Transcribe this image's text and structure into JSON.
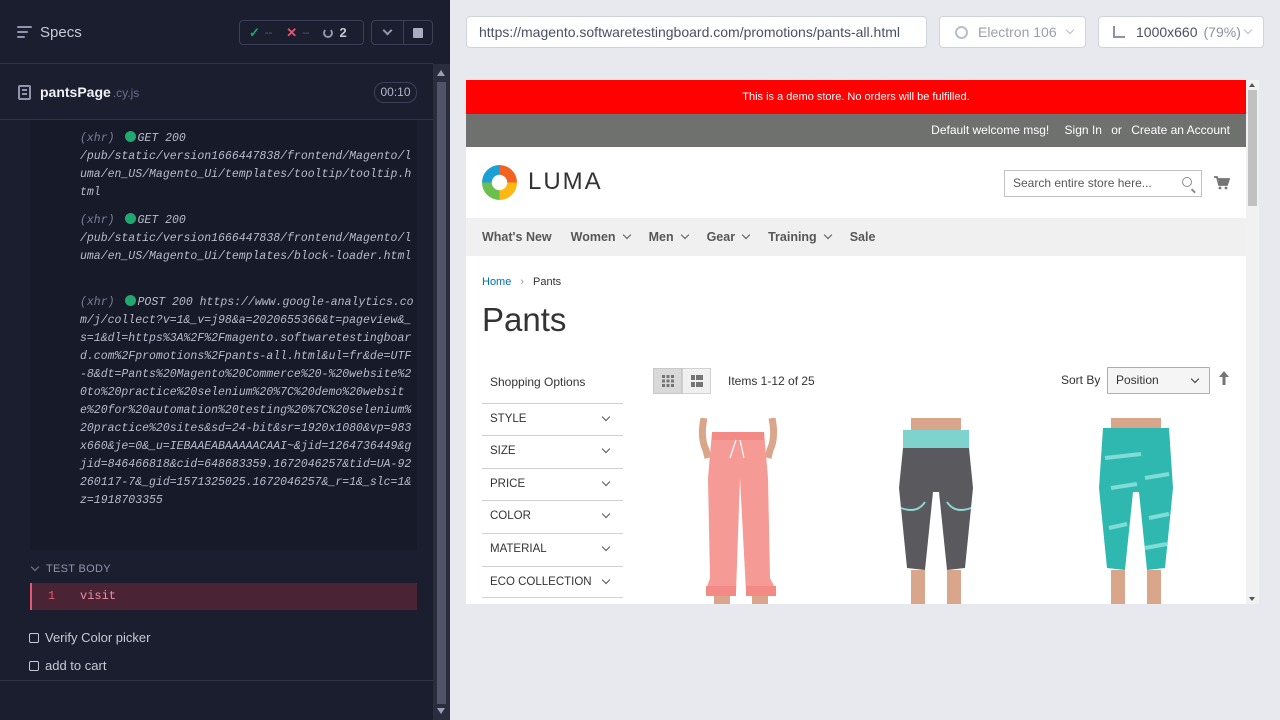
{
  "runner": {
    "specs_title": "Specs",
    "stats": {
      "passed": "--",
      "failed": "--",
      "pending": "2"
    },
    "spec": {
      "name": "pantsPage",
      "ext": ".cy.js",
      "duration": "00:10"
    },
    "log_entries": [
      {
        "prefix": "(xhr)",
        "method": "GET 200",
        "text": "/pub/static/version1666447838/frontend/Magento/luma/en_US/Magento_Ui/templates/tooltip/tooltip.html"
      },
      {
        "prefix": "(xhr)",
        "method": "GET 200",
        "text": "/pub/static/version1666447838/frontend/Magento/luma/en_US/Magento_Ui/templates/block-loader.html"
      },
      {
        "prefix": "(xhr)",
        "method": "POST 200",
        "text": "https://www.google-analytics.com/j/collect?v=1&_v=j98&a=2020655366&t=pageview&_s=1&dl=https%3A%2F%2Fmagento.softwaretestingboard.com%2Fpromotions%2Fpants-all.html&ul=fr&de=UTF-8&dt=Pants%20Magento%20Commerce%20-%20website%20to%20practice%20selenium%20%7C%20demo%20website%20for%20automation%20testing%20%7C%20selenium%20practice%20sites&sd=24-bit&sr=1920x1080&vp=983x660&je=0&_u=IEBAAEABAAAAACAAI~&jid=1264736449&gjid=846466818&cid=648683359.1672046257&tid=UA-92260117-7&_gid=1571325025.1672046257&_r=1&_slc=1&z=1918703355"
      }
    ],
    "test_body_label": "TEST BODY",
    "command": {
      "number": "1",
      "name": "visit"
    },
    "tests": [
      "Verify Color picker",
      "add to cart"
    ]
  },
  "browser": {
    "url": "https://magento.softwaretestingboard.com/promotions/pants-all.html",
    "browser_name": "Electron 106",
    "viewport": "1000x660",
    "scale": "(79%)"
  },
  "store": {
    "demo_notice": "This is a demo store. No orders will be fulfilled.",
    "welcome": "Default welcome msg!",
    "sign_in": "Sign In",
    "or": "or",
    "create_account": "Create an Account",
    "logo_text": "LUMA",
    "search_placeholder": "Search entire store here...",
    "nav": [
      "What's New",
      "Women",
      "Men",
      "Gear",
      "Training",
      "Sale"
    ],
    "breadcrumb_home": "Home",
    "breadcrumb_current": "Pants",
    "page_title": "Pants",
    "shopping_options": "Shopping Options",
    "filters": [
      "STYLE",
      "SIZE",
      "PRICE",
      "COLOR",
      "MATERIAL",
      "ECO COLLECTION"
    ],
    "items_count": "Items 1-12 of 25",
    "sort_label": "Sort By",
    "sort_value": "Position",
    "colors": {
      "notice": "#ff0101",
      "link": "#006bb4",
      "panel": "#6e716e"
    }
  }
}
